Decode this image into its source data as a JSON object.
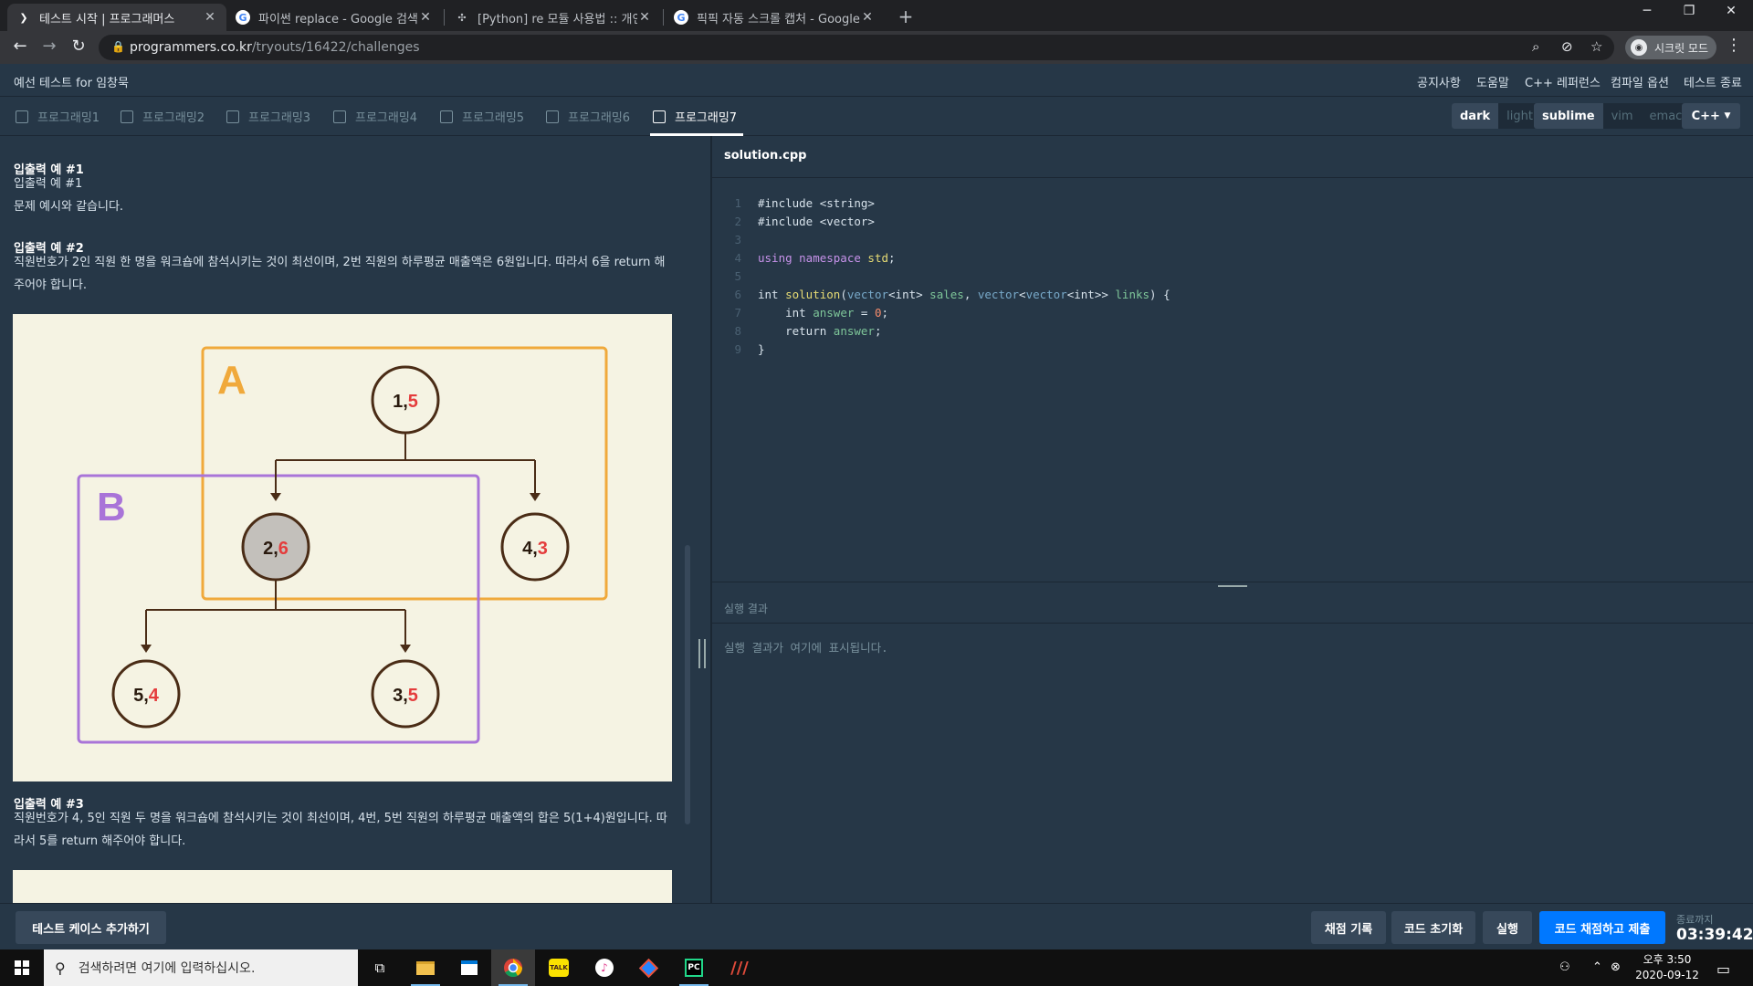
{
  "browser": {
    "tabs": [
      {
        "title": "테스트 시작 | 프로그래머스",
        "active": true
      },
      {
        "title": "파이썬 replace - Google 검색",
        "active": false
      },
      {
        "title": "[Python] re 모듈 사용법 :: 개인공",
        "active": false
      },
      {
        "title": "픽픽 자동 스크롤 캡처 - Google",
        "active": false
      }
    ],
    "url_host": "programmers.co.kr",
    "url_path": "/tryouts/16422/challenges",
    "profile_label": "시크릿 모드"
  },
  "header": {
    "test_name": "예선 테스트 for 임창묵",
    "links": [
      "공지사항",
      "도움말",
      "C++ 레퍼런스",
      "컴파일 옵션",
      "테스트 종료"
    ]
  },
  "problem_tabs": [
    "프로그래밍1",
    "프로그래밍2",
    "프로그래밍3",
    "프로그래밍4",
    "프로그래밍5",
    "프로그래밍6",
    "프로그래밍7"
  ],
  "active_problem_index": 6,
  "themes": {
    "color": [
      "dark",
      "light"
    ],
    "color_selected": "dark",
    "keymap": [
      "sublime",
      "vim",
      "emacs"
    ],
    "keymap_selected": "sublime"
  },
  "language": "C++",
  "problem": {
    "ex1_heading": "입출력 예 #1",
    "ex1_line1": "입출력 예 #1",
    "ex1_line2": "문제 예시와 같습니다.",
    "ex2_heading": "입출력 예 #2",
    "ex2_text": "직원번호가 2인 직원 한 명을 워크숍에 참석시키는 것이 최선이며, 2번 직원의 하루평균 매출액은 6원입니다. 따라서 6을 return 해주어야 합니다.",
    "ex3_heading": "입출력 예 #3",
    "ex3_text": "직원번호가 4, 5인 직원 두 명을 워크숍에 참석시키는 것이 최선이며, 4번, 5번 직원의 하루평균 매출액의 합은 5(1+4)원입니다. 따라서 5를 return 해주어야 합니다."
  },
  "diagram": {
    "group_a_label": "A",
    "group_b_label": "B",
    "nodes": [
      {
        "id": "1",
        "sales": "5",
        "highlighted": false
      },
      {
        "id": "2",
        "sales": "6",
        "highlighted": true
      },
      {
        "id": "4",
        "sales": "3",
        "highlighted": false
      },
      {
        "id": "5",
        "sales": "4",
        "highlighted": false
      },
      {
        "id": "3",
        "sales": "5",
        "highlighted": false
      }
    ],
    "edges": [
      [
        "1",
        "2"
      ],
      [
        "1",
        "4"
      ],
      [
        "2",
        "5"
      ],
      [
        "2",
        "3"
      ]
    ],
    "colors": {
      "group_a": "#f0a93b",
      "group_b": "#a974d8",
      "sales": "#e43c3c",
      "node_border": "#4a2c16",
      "highlight_fill": "#c3c0bb",
      "background": "#f5f3e3"
    }
  },
  "editor": {
    "file_name": "solution.cpp",
    "line_numbers": [
      "1",
      "2",
      "3",
      "4",
      "5",
      "6",
      "7",
      "8",
      "9"
    ]
  },
  "result": {
    "title": "실행 결과",
    "placeholder": "실행 결과가 여기에 표시됩니다."
  },
  "actions": {
    "add_test_case": "테스트 케이스 추가하기",
    "grading_history": "채점 기록",
    "reset_code": "코드 초기화",
    "run": "실행",
    "submit": "코드 채점하고 제출",
    "timer_label": "종료까지",
    "timer": "03:39:42"
  },
  "taskbar": {
    "search_placeholder": "검색하려면 여기에 입력하십시오.",
    "time": "오후 3:50",
    "date": "2020-09-12"
  }
}
